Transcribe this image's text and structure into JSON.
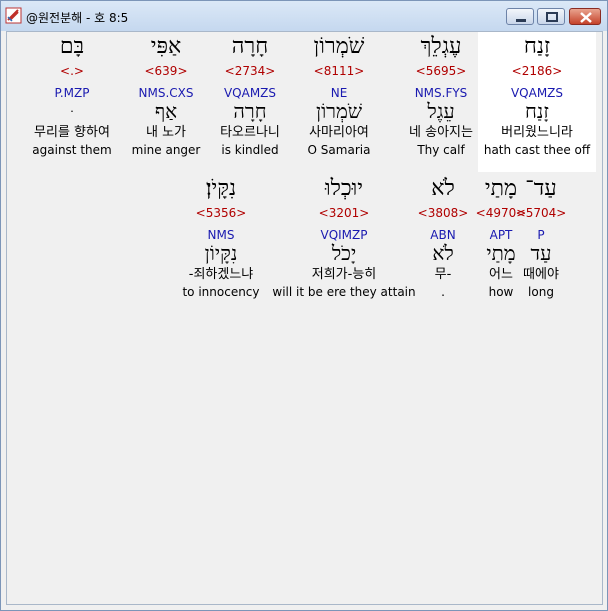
{
  "window": {
    "title": "@원전분해 - 호 8:5"
  },
  "rows": [
    {
      "words": [
        {
          "heb": "זָנַח",
          "strong": "<2186>",
          "pos": "VQAMZS",
          "heb2": "זָנַח",
          "kor": "버리웠느니라",
          "eng": "hath cast thee off",
          "highlight": true
        },
        {
          "heb": "עֶגְלֵךְ",
          "strong": "<5695>",
          "pos": "NMS.FYS",
          "heb2": "עֵגֶל",
          "kor": "네 송아지는",
          "eng": "Thy calf",
          "highlight": false
        },
        {
          "heb": "שֹׁמְרוֹן",
          "strong": "<8111>",
          "pos": "NE",
          "heb2": "שֹׁמְרוֹן",
          "kor": "사마리아여",
          "eng": "O Samaria",
          "highlight": false
        },
        {
          "heb": "חָרָה",
          "strong": "<2734>",
          "pos": "VQAMZS",
          "heb2": "חָרָה",
          "kor": "타오르나니",
          "eng": "is kindled",
          "highlight": false
        },
        {
          "heb": "אַפִּי",
          "strong": "<639>",
          "pos": "NMS.CXS",
          "heb2": "אַף",
          "kor": "내 노가",
          "eng": "mine anger",
          "highlight": false
        },
        {
          "heb": "בָּם",
          "strong": "<.>",
          "pos": "P.MZP",
          "heb2": "ּ",
          "kor": "무리를 향하여",
          "eng": "against them",
          "highlight": false
        }
      ]
    },
    {
      "words": [
        {
          "heb": "עַד־",
          "strong": "<5704>",
          "pos": "P",
          "heb2": "עַד",
          "kor": "때에야",
          "eng": "long",
          "highlight": false
        },
        {
          "heb": "מָתַי",
          "strong": "<4970>",
          "pos": "APT",
          "heb2": "מָתַי",
          "kor": "어느",
          "eng": "how",
          "highlight": false
        },
        {
          "heb": "לֹא",
          "strong": "<3808>",
          "pos": "ABN",
          "heb2": "לֹא",
          "kor": "무-",
          "eng": ".",
          "highlight": false
        },
        {
          "heb": "יוּכְלוּ",
          "strong": "<3201>",
          "pos": "VQIMZP",
          "heb2": "יָכֹל",
          "kor": "저희가-능히",
          "eng": "will it be ere they attain",
          "highlight": false
        },
        {
          "heb": "נִקָּיֹן׃",
          "strong": "<5356>",
          "pos": "NMS",
          "heb2": "נִקָּיוֹן",
          "kor": "-죄하겠느냐",
          "eng": "to innocency",
          "highlight": false
        }
      ]
    }
  ]
}
